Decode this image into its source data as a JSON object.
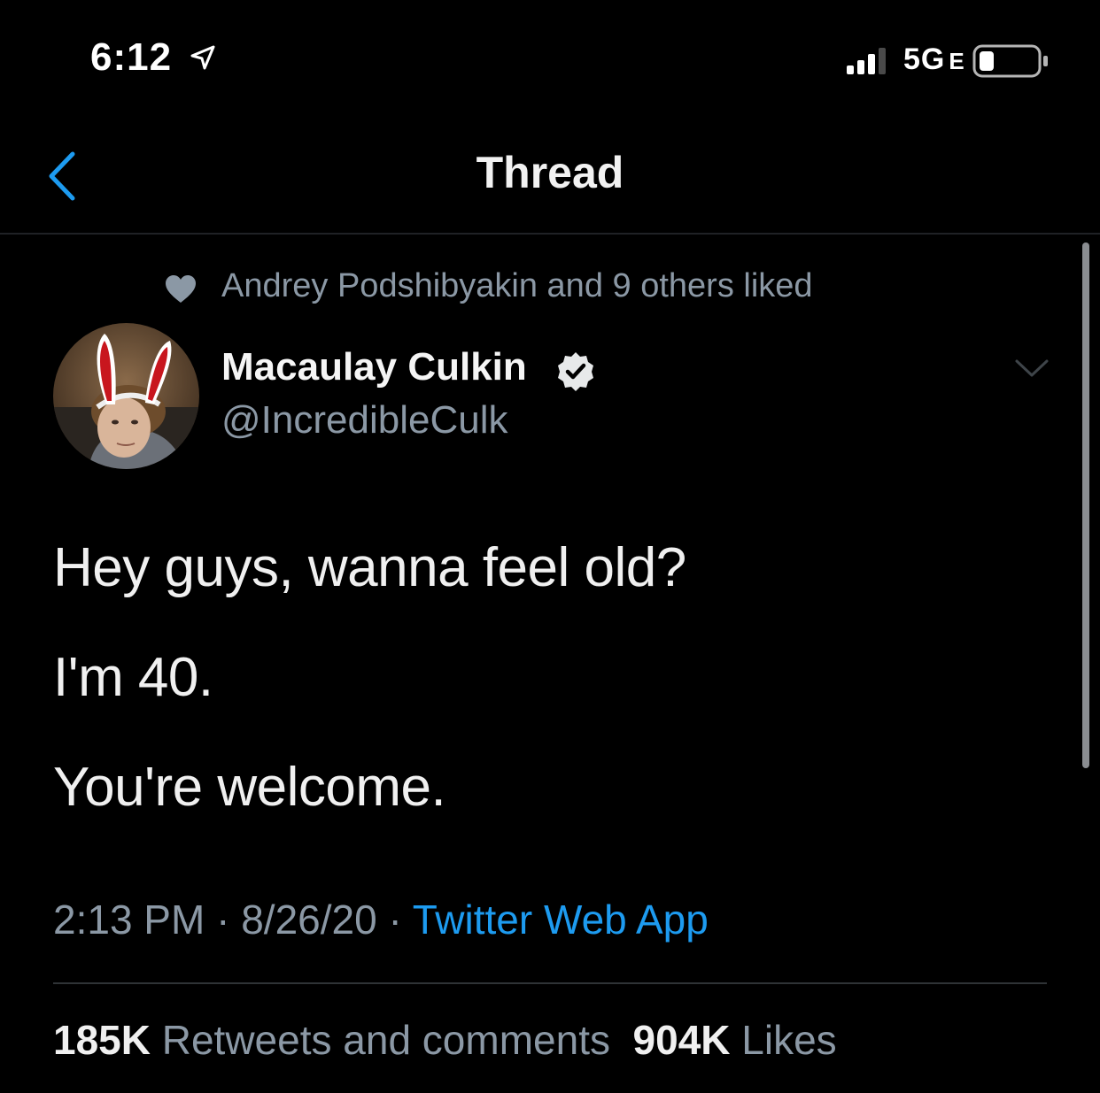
{
  "status_bar": {
    "time": "6:12",
    "network": "5G",
    "network_suffix": "E",
    "icons": [
      "location-arrow-icon",
      "signal-bars-icon",
      "battery-icon"
    ]
  },
  "nav": {
    "title": "Thread",
    "back_icon": "chevron-left-icon"
  },
  "tweet": {
    "social_context": "Andrey Podshibyakin and 9 others liked",
    "author": {
      "name": "Macaulay Culkin",
      "handle": "@IncredibleCulk",
      "verified": true
    },
    "text_lines": [
      "Hey guys, wanna feel old?",
      "I'm 40.",
      "You're welcome."
    ],
    "time": "2:13 PM",
    "date": "8/26/20",
    "separator": "·",
    "source": "Twitter Web App",
    "retweets_count": "185K",
    "retweets_label": "Retweets and comments",
    "likes_count": "904K",
    "likes_label": "Likes"
  },
  "colors": {
    "background": "#000000",
    "accent": "#1d9bf0",
    "secondary_text": "#8b98a5",
    "divider": "#2f3336"
  }
}
